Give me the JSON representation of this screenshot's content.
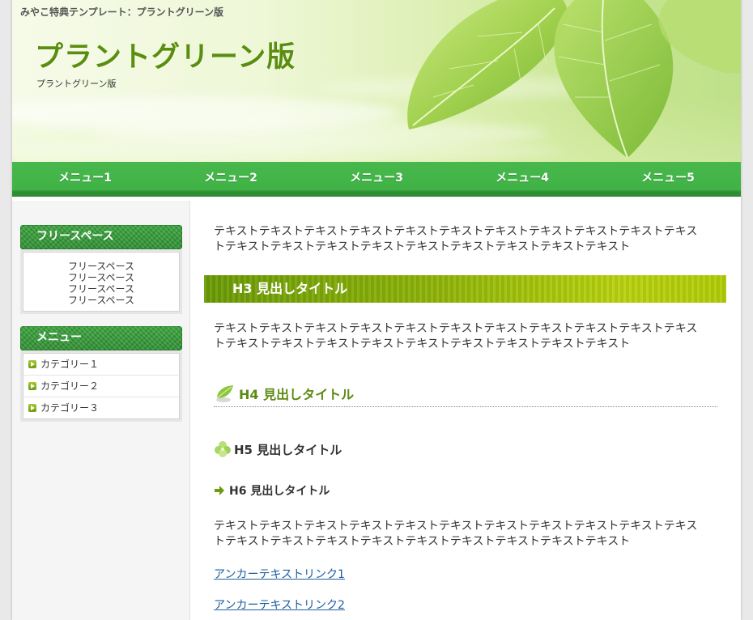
{
  "header": {
    "tagline": "みやこ特典テンプレート：プラントグリーン版",
    "site_title": "プラントグリーン版",
    "site_subtitle": "プラントグリーン版"
  },
  "nav": {
    "items": [
      "メニュー1",
      "メニュー2",
      "メニュー3",
      "メニュー4",
      "メニュー5"
    ]
  },
  "sidebar": {
    "free_space": {
      "title": "フリースペース",
      "lines": [
        "フリースペース",
        "フリースペース",
        "フリースペース",
        "フリースペース"
      ]
    },
    "menu": {
      "title": "メニュー",
      "categories": [
        "カテゴリー１",
        "カテゴリー２",
        "カテゴリー３"
      ]
    }
  },
  "main": {
    "paragraph1": "テキストテキストテキストテキストテキストテキストテキストテキストテキストテキストテキストテキストテキストテキストテキストテキストテキストテキストテキストテキスト",
    "h3": "H3 見出しタイトル",
    "paragraph2": "テキストテキストテキストテキストテキストテキストテキストテキストテキストテキストテキストテキストテキストテキストテキストテキストテキストテキストテキストテキスト",
    "h4": "H4 見出しタイトル",
    "h5": "H5 見出しタイトル",
    "h6": "H6 見出しタイトル",
    "paragraph3": "テキストテキストテキストテキストテキストテキストテキストテキストテキストテキストテキストテキストテキストテキストテキストテキストテキストテキストテキストテキスト",
    "links": [
      "アンカーテキストリンク1",
      "アンカーテキストリンク2"
    ]
  },
  "colors": {
    "nav_green": "#3fb246",
    "title_green": "#5a8e0e",
    "link_blue": "#1f5fa0"
  }
}
